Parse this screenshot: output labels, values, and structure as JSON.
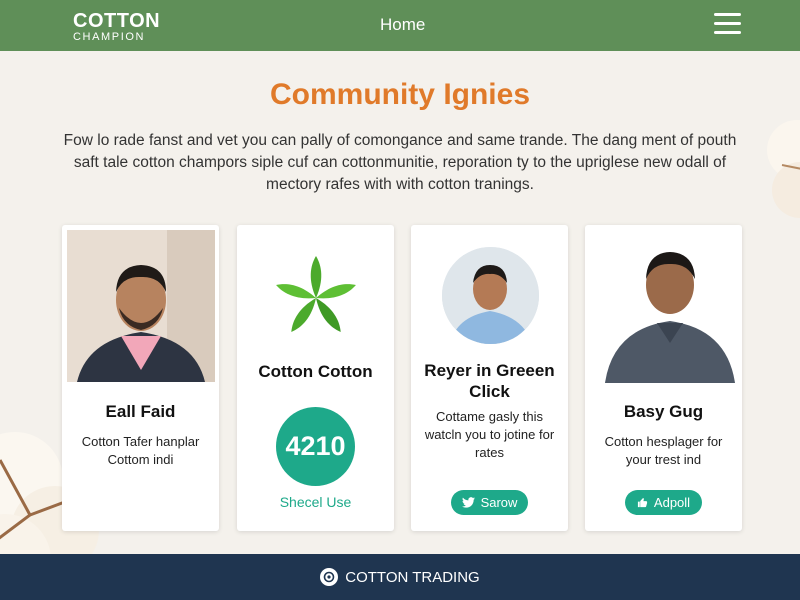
{
  "header": {
    "logo_main": "COTTON",
    "logo_sub": "CHAMPION",
    "nav_home": "Home",
    "background": "#5f8f58"
  },
  "hero": {
    "title": "Community Ignies",
    "description": "Fow lo rade fanst and vet you can pally of comongance and same trande. The dang ment of pouth saft tale cotton champors siple cuf can cottonmunitie, reporation ty to the upriglese new odall of mectory rafes with with cotton tranings.",
    "title_color": "#e07a2a"
  },
  "cards": [
    {
      "name": "Eall Faid",
      "description": "Cotton Tafer hanplar Cottom indi"
    },
    {
      "name": "Cotton Cotton",
      "stat": "4210",
      "link": "Shecel Use",
      "icon": "leaf-star-icon"
    },
    {
      "name": "Reyer in Greeen Click",
      "description": "Cottame gasly this watcln you to jotine for rates",
      "button": "Sarow",
      "button_icon": "twitter-icon"
    },
    {
      "name": "Basy Gug",
      "description": "Cotton hesplager for your trest ind",
      "button": "Adpoll",
      "button_icon": "thumbs-up-icon"
    }
  ],
  "footer": {
    "label": "COTTON TRADING",
    "icon": "cotton-coin-icon",
    "background": "#1f3550"
  },
  "accent": "#1ea98a"
}
